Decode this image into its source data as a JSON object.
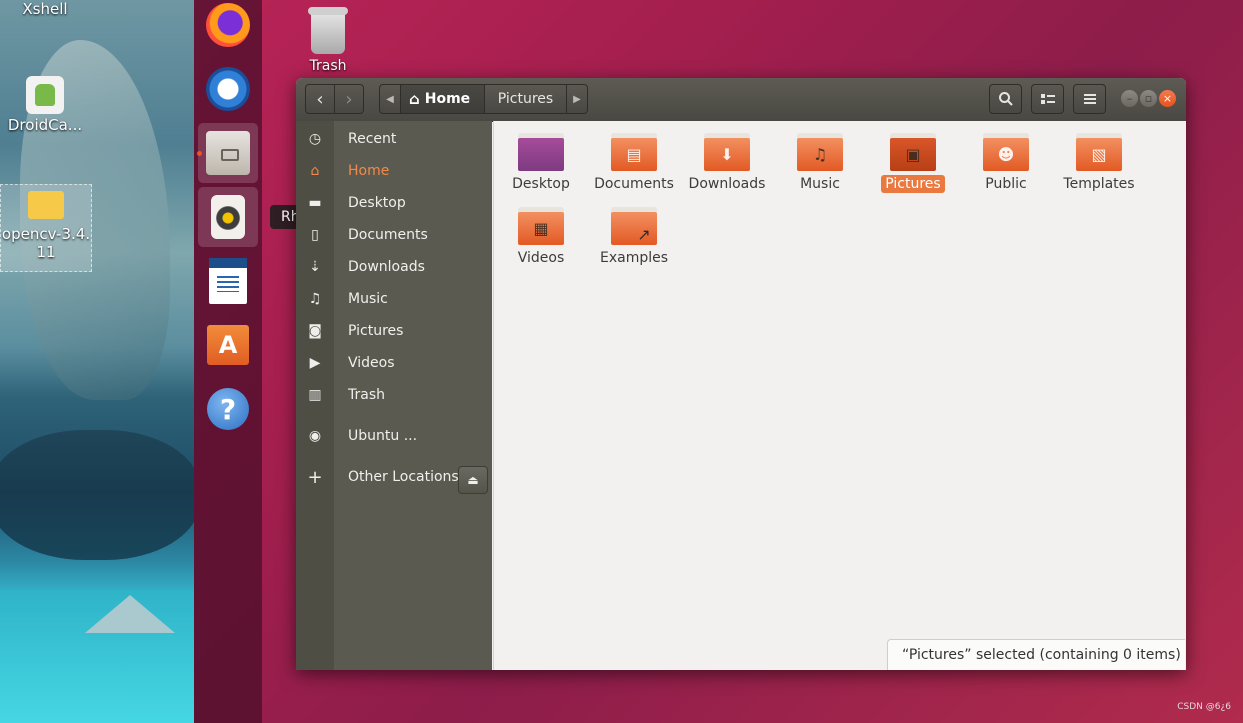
{
  "desktop_icons": [
    {
      "label": "Xshell"
    },
    {
      "label": "DroidCa..."
    },
    {
      "label": "opencv-3.4.\n11"
    }
  ],
  "desktop_trash_label": "Trash",
  "dock": {
    "tooltip": "Rhythmbox",
    "items": [
      "Firefox",
      "Thunderbird",
      "Files",
      "Rhythmbox",
      "LibreOffice Writer",
      "Ubuntu Software",
      "Help"
    ]
  },
  "window": {
    "breadcrumb": {
      "home": "Home",
      "current": "Pictures"
    },
    "sidebar": [
      {
        "label": "Recent",
        "icon": "clock-icon"
      },
      {
        "label": "Home",
        "icon": "home-icon"
      },
      {
        "label": "Desktop",
        "icon": "folder-icon"
      },
      {
        "label": "Documents",
        "icon": "document-icon"
      },
      {
        "label": "Downloads",
        "icon": "download-icon"
      },
      {
        "label": "Music",
        "icon": "music-icon"
      },
      {
        "label": "Pictures",
        "icon": "camera-icon"
      },
      {
        "label": "Videos",
        "icon": "video-icon"
      },
      {
        "label": "Trash",
        "icon": "trash-icon"
      },
      {
        "label": "Ubuntu ...",
        "icon": "disc-icon"
      },
      {
        "label": "Other Locations",
        "icon": "plus-icon"
      }
    ],
    "folders": [
      {
        "label": "Desktop"
      },
      {
        "label": "Documents"
      },
      {
        "label": "Downloads"
      },
      {
        "label": "Music"
      },
      {
        "label": "Pictures"
      },
      {
        "label": "Public"
      },
      {
        "label": "Templates"
      },
      {
        "label": "Videos"
      },
      {
        "label": "Examples"
      }
    ],
    "status": "“Pictures” selected  (containing 0 items)"
  },
  "watermark": "CSDN @6¿6",
  "colors": {
    "accent": "#e9793f",
    "dock": "#460e28",
    "sidebar": "#5b5a50"
  }
}
